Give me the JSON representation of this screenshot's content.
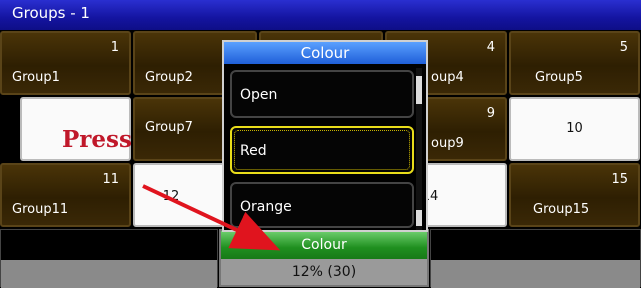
{
  "window": {
    "title": "Groups - 1"
  },
  "groups": [
    {
      "num": "1",
      "name": "Group1"
    },
    {
      "num": "",
      "name": "Group2"
    },
    {
      "num": "",
      "name": ""
    },
    {
      "num": "4",
      "name": "oup4"
    },
    {
      "num": "5",
      "name": "Group5"
    },
    {
      "num": "",
      "name": ""
    },
    {
      "num": "",
      "name": "Group7"
    },
    {
      "num": "",
      "name": ""
    },
    {
      "num": "9",
      "name": "oup9"
    },
    {
      "num": "10",
      "name": ""
    },
    {
      "num": "11",
      "name": "Group11"
    },
    {
      "num": "12",
      "name": ""
    },
    {
      "num": "",
      "name": ""
    },
    {
      "num": "14",
      "name": ""
    },
    {
      "num": "15",
      "name": "Group15"
    }
  ],
  "popup": {
    "title": "Colour",
    "options": [
      "Open",
      "Red",
      "Orange"
    ],
    "selected": "Red"
  },
  "bottom_tab": {
    "label": "Colour",
    "value": "12% (30)"
  },
  "annotation": {
    "text": "Press",
    "color": "#c0182a"
  },
  "colors": {
    "title_bar": "#1414a0",
    "group_button": "#3a2806",
    "selection_highlight": "#e8dc1a",
    "tab_green": "#1f8f1f"
  }
}
